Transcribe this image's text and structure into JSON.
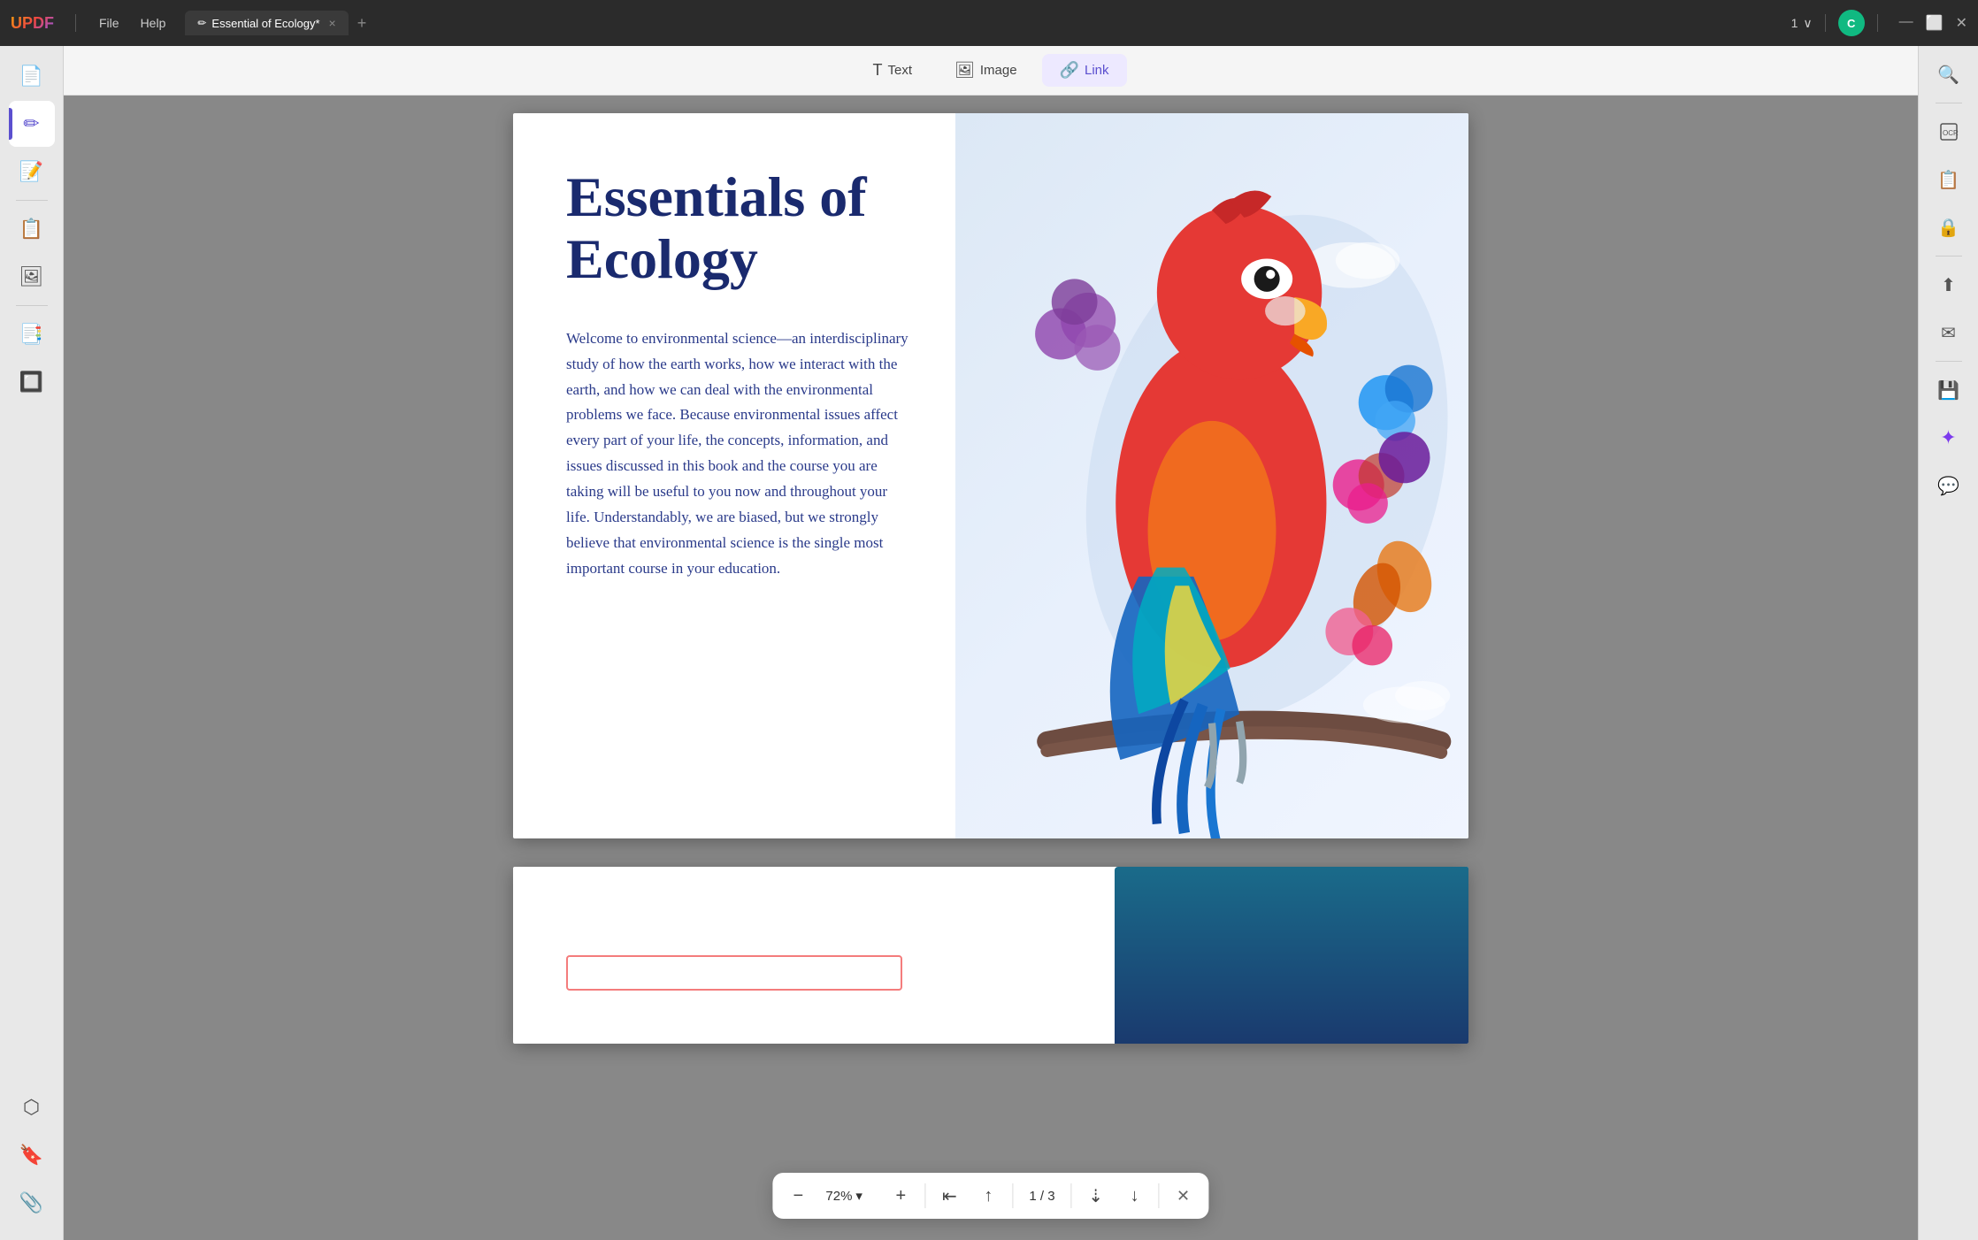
{
  "app": {
    "name": "UPDF",
    "logo_text": "UPDF"
  },
  "titlebar": {
    "menu_items": [
      "File",
      "Help"
    ],
    "tab_title": "Essential of Ecology*",
    "tab_icon": "✏️",
    "close_label": "×",
    "add_tab_label": "+",
    "page_display": "1",
    "page_nav_arrow": "∨",
    "avatar_letter": "C",
    "win_minimize": "—",
    "win_maximize": "⬜",
    "win_close": "✕"
  },
  "toolbar": {
    "text_label": "Text",
    "text_icon": "T",
    "image_label": "Image",
    "image_icon": "🖼",
    "link_label": "Link",
    "link_icon": "🔗"
  },
  "sidebar": {
    "items": [
      {
        "icon": "📄",
        "name": "reader"
      },
      {
        "icon": "✏️",
        "name": "edit"
      },
      {
        "icon": "📝",
        "name": "annotate"
      },
      {
        "icon": "📋",
        "name": "organize"
      },
      {
        "icon": "🖼",
        "name": "image-tool"
      },
      {
        "icon": "📑",
        "name": "form"
      },
      {
        "icon": "🔲",
        "name": "convert"
      }
    ],
    "bottom_items": [
      {
        "icon": "⬡",
        "name": "layers"
      },
      {
        "icon": "🔖",
        "name": "bookmark"
      },
      {
        "icon": "📎",
        "name": "attachment"
      }
    ]
  },
  "right_panel": {
    "items": [
      {
        "icon": "🔍",
        "name": "search"
      },
      {
        "icon": "📷",
        "name": "ocr"
      },
      {
        "icon": "📋",
        "name": "extract"
      },
      {
        "icon": "🔒",
        "name": "protect"
      },
      {
        "icon": "⬆",
        "name": "share"
      },
      {
        "icon": "✉",
        "name": "email"
      },
      {
        "icon": "💾",
        "name": "save"
      },
      {
        "icon": "✦",
        "name": "ai"
      },
      {
        "icon": "💬",
        "name": "comment"
      }
    ]
  },
  "pdf": {
    "title": "Essentials of Ecology",
    "body_text": "Welcome to environmental science—an interdisciplinary study of how the earth works, how we interact with the earth, and how we can deal with the environmental problems we face. Because environmental issues affect every part of your life, the concepts, information, and issues discussed in this book and the course you are taking will be useful to you now and throughout your life. Understandably, we are biased, but we strongly believe that environmental science is the single most important course in your education."
  },
  "bottom_bar": {
    "zoom_out": "−",
    "zoom_level": "72%",
    "zoom_dropdown": "▾",
    "zoom_in": "+",
    "page_first": "⇤",
    "page_prev_prev": "↑",
    "page_current": "1",
    "page_separator": "/",
    "page_total": "3",
    "page_next_next": "⇣",
    "page_next": "↓",
    "close": "✕"
  }
}
